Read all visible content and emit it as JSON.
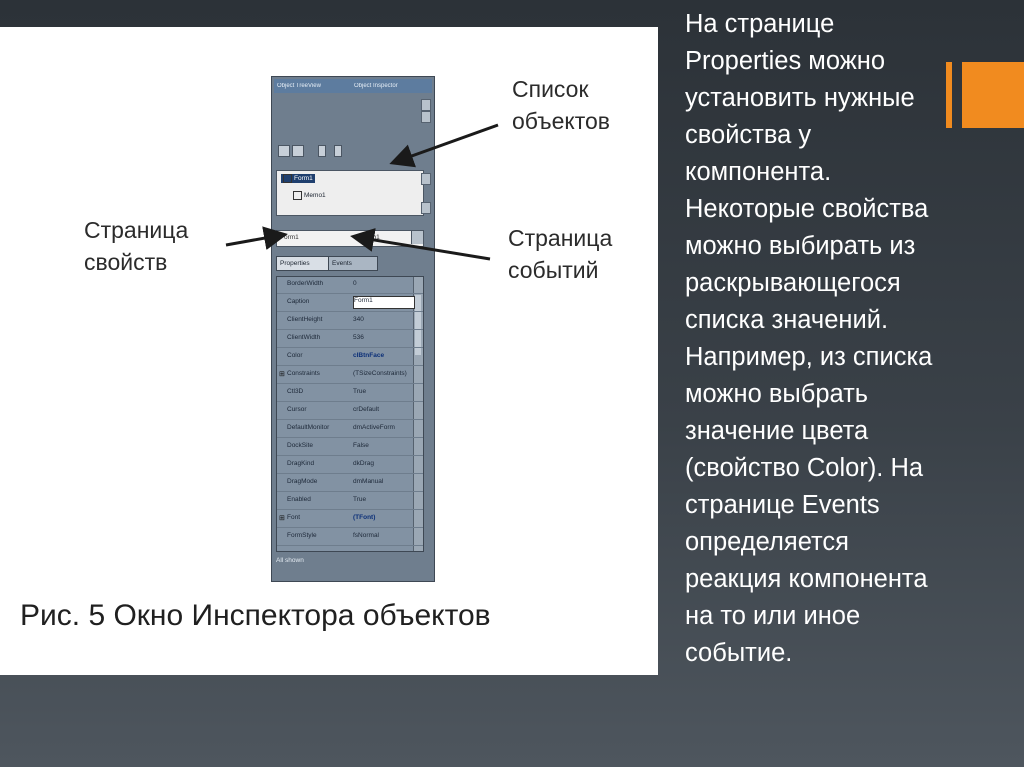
{
  "slide": {
    "body_lines": [
      "На странице",
      "Properties можно",
      "установить нужные",
      "свойства у",
      "компонента.",
      "Некоторые свойства",
      "можно выбирать из",
      "раскрывающегося",
      "списка значений.",
      "Например, из списка",
      "можно выбрать",
      "значение цвета",
      "(свойство Color). На",
      "странице Events",
      "определяется",
      "реакция компонента",
      "на то или иное",
      "событие."
    ],
    "accent_color": "#f18b1f"
  },
  "figure": {
    "caption": "Рис. 5 Окно Инспектора объектов",
    "annotations": {
      "objects_list": [
        "Список",
        "объектов"
      ],
      "properties_page": [
        "Страница",
        "свойств"
      ],
      "events_page": [
        "Страница",
        "событий"
      ]
    },
    "inspector": {
      "title_tabs": [
        "Object TreeView",
        "Object Inspector"
      ],
      "tree_items": [
        "Form1",
        "Memo1"
      ],
      "selector": {
        "name": "Form1",
        "type": "TForm1"
      },
      "page_tabs": [
        "Properties",
        "Events"
      ],
      "properties": [
        {
          "name": "BorderWidth",
          "value": "0"
        },
        {
          "name": "Caption",
          "value": "Form1"
        },
        {
          "name": "ClientHeight",
          "value": "340"
        },
        {
          "name": "ClientWidth",
          "value": "536"
        },
        {
          "name": "Color",
          "value": "clBtnFace"
        },
        {
          "name": "Constraints",
          "value": "(TSizeConstraints)"
        },
        {
          "name": "Ctl3D",
          "value": "True"
        },
        {
          "name": "Cursor",
          "value": "crDefault"
        },
        {
          "name": "DefaultMonitor",
          "value": "dmActiveForm"
        },
        {
          "name": "DockSite",
          "value": "False"
        },
        {
          "name": "DragKind",
          "value": "dkDrag"
        },
        {
          "name": "DragMode",
          "value": "dmManual"
        },
        {
          "name": "Enabled",
          "value": "True"
        },
        {
          "name": "Font",
          "value": "(TFont)"
        },
        {
          "name": "FormStyle",
          "value": "fsNormal"
        }
      ],
      "status": "All shown"
    }
  }
}
